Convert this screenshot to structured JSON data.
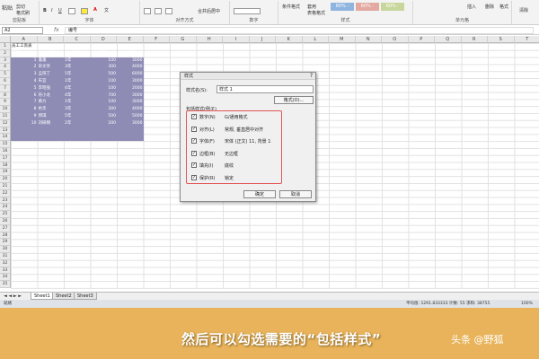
{
  "ribbon": {
    "paste": "粘贴",
    "cut": "剪切",
    "format_painter": "格式刷",
    "clipboard": "剪贴板",
    "font": "字体",
    "alignment": "对齐方式",
    "merge_center": "合并后居中",
    "number": "数字",
    "conditional_format": "条件格式",
    "table_format": "套用\n表格格式",
    "style_badge": "60% -",
    "styles": "样式",
    "insert": "插入",
    "delete": "删除",
    "format": "格式",
    "cells": "单元格",
    "clear": "清除"
  },
  "formula_bar": {
    "name_box": "A2",
    "fx": "fx",
    "content": "编号"
  },
  "columns": [
    "A",
    "B",
    "C",
    "D",
    "E",
    "F",
    "G",
    "H",
    "I",
    "J",
    "K",
    "L",
    "M",
    "N",
    "O",
    "P",
    "Q",
    "R",
    "S",
    "T"
  ],
  "rows": [
    "1",
    "2",
    "3",
    "4",
    "5",
    "6",
    "7",
    "8",
    "9",
    "10",
    "11",
    "12",
    "13",
    "14",
    "15",
    "16",
    "17",
    "18",
    "19",
    "20",
    "21",
    "22",
    "23",
    "24",
    "25",
    "26",
    "27",
    "28",
    "29",
    "30",
    "31",
    "32",
    "33",
    "34",
    "35"
  ],
  "sheet": {
    "title": "员工工资表",
    "headers": [
      "编号",
      "姓名",
      "工龄",
      "奖金",
      "工资"
    ],
    "data": [
      [
        "1",
        "蓬蓬",
        "1年",
        "100",
        "3000"
      ],
      [
        "2",
        "宋文亭",
        "3年",
        "300",
        "4000"
      ],
      [
        "3",
        "孟阳丁",
        "5年",
        "500",
        "6000"
      ],
      [
        "4",
        "布宜",
        "1年",
        "100",
        "3000"
      ],
      [
        "5",
        "李昭强",
        "4年",
        "100",
        "2000"
      ],
      [
        "6",
        "符小龙",
        "4年",
        "700",
        "3000"
      ],
      [
        "7",
        "黄力",
        "1年",
        "100",
        "3000"
      ],
      [
        "8",
        "杭华",
        "3年",
        "300",
        "4000"
      ],
      [
        "9",
        "郭琪",
        "5年",
        "500",
        "5000"
      ],
      [
        "10",
        "刘研翱",
        "2年",
        "200",
        "3000"
      ]
    ]
  },
  "tabs": [
    "Sheet1",
    "Sheet2",
    "Sheet3"
  ],
  "status": {
    "ready": "就绪",
    "summary": "平均值: 1291.833333   计数: 55   求和: 38755",
    "zoom": "100%"
  },
  "dialog": {
    "title": "样式",
    "close": "?",
    "style_name_label": "样式名(S):",
    "style_name_value": "样式 1",
    "format_button": "格式(O)...",
    "includes_label": "包括样式(例子)",
    "options": [
      {
        "label": "数字(N)",
        "value": "G/通用格式",
        "checked": true
      },
      {
        "label": "对齐(L)",
        "value": "常规, 垂直居中对齐",
        "checked": true
      },
      {
        "label": "字体(F)",
        "value": "宋体 (正文) 11, 背景 1",
        "checked": true
      },
      {
        "label": "边框(B)",
        "value": "无边框",
        "checked": true
      },
      {
        "label": "填充(I)",
        "value": "底纹",
        "checked": true
      },
      {
        "label": "保护(R)",
        "value": "锁定",
        "checked": true
      }
    ],
    "ok": "确定",
    "cancel": "取消"
  },
  "caption": {
    "text": "然后可以勾选需要的“包括样式”",
    "watermark": "头条 @野狐"
  },
  "colors": {
    "selection": "#8e8bb5",
    "caption_bg": "#e8b35a",
    "highlight_border": "#e25757"
  }
}
